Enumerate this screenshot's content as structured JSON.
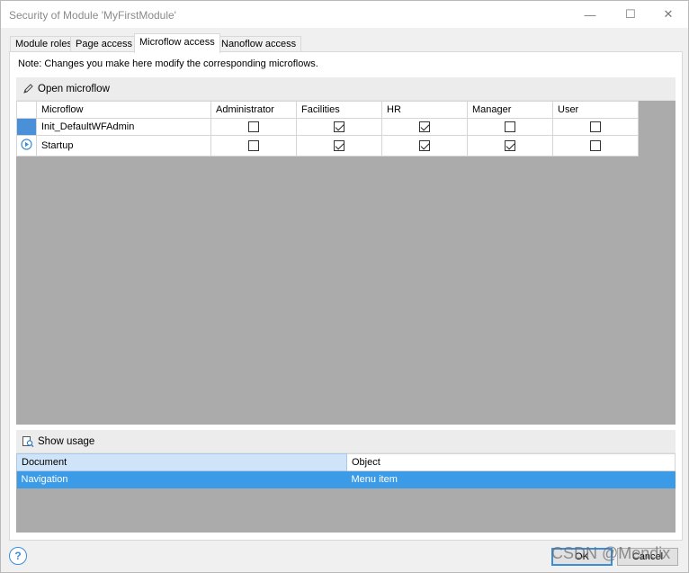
{
  "window": {
    "title": "Security of Module 'MyFirstModule'",
    "controls": {
      "minimize": "—",
      "maximize": "☐",
      "close": "✕"
    }
  },
  "tabs": [
    {
      "label": "Module roles",
      "active": false
    },
    {
      "label": "Page access",
      "active": false
    },
    {
      "label": "Microflow access",
      "active": true
    },
    {
      "label": "Nanoflow access",
      "active": false
    }
  ],
  "note": "Note: Changes you make here modify the corresponding microflows.",
  "toolbar": {
    "open_label": "Open microflow",
    "open_icon": "pencil-icon"
  },
  "grid": {
    "columns": [
      "Microflow",
      "Administrator",
      "Facilities",
      "HR",
      "Manager",
      "User"
    ],
    "rows": [
      {
        "name": "Init_DefaultWFAdmin",
        "access": [
          false,
          true,
          true,
          false,
          false
        ],
        "selected": true
      },
      {
        "name": "Startup",
        "access": [
          false,
          true,
          true,
          true,
          false
        ],
        "icon": "play-circle-icon"
      }
    ]
  },
  "usage": {
    "show_label": "Show usage",
    "show_icon": "usage-icon",
    "columns": [
      "Document",
      "Object"
    ],
    "rows": [
      {
        "document": "Navigation",
        "object": "Menu item"
      }
    ]
  },
  "buttons": {
    "ok": "OK",
    "cancel": "Cancel",
    "help": "?"
  },
  "watermark": "CSDN @Mendix",
  "colors": {
    "accent": "#3b8dd9",
    "selection": "#3b9be6",
    "grid_bg": "#ababab"
  }
}
